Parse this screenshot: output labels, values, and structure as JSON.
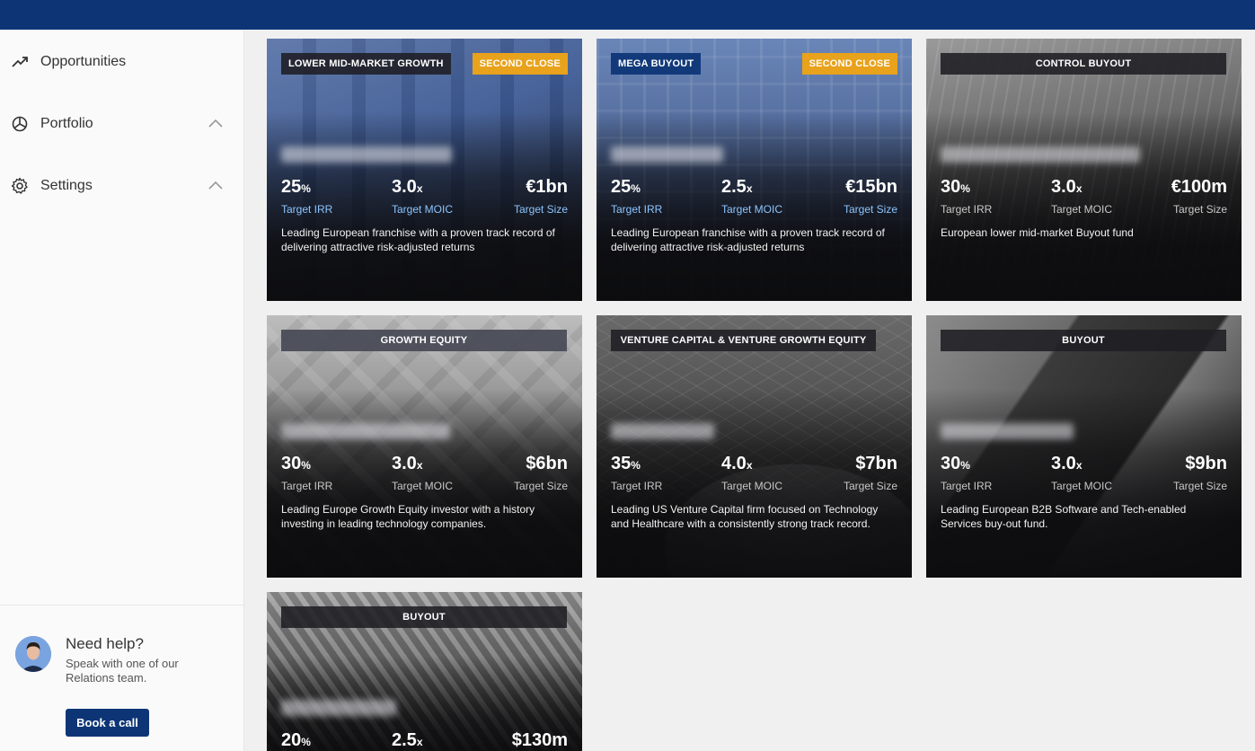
{
  "sidebar": {
    "items": [
      {
        "label": "Opportunities",
        "icon": "trending-up-icon"
      },
      {
        "label": "Portfolio",
        "icon": "pie-chart-icon"
      },
      {
        "label": "Settings",
        "icon": "gear-icon"
      }
    ]
  },
  "help": {
    "title": "Need help?",
    "line1": "Speak with one of our",
    "line2": "Relations team.",
    "button": "Book a call"
  },
  "cards": [
    {
      "tag": "LOWER MID-MARKET GROWTH",
      "badge": "SECOND CLOSE",
      "irr": "25",
      "irr_unit": "%",
      "moic": "3.0",
      "moic_unit": "x",
      "size": "€1bn",
      "irr_label": "Target IRR",
      "moic_label": "Target MOIC",
      "size_label": "Target Size",
      "desc": "Leading European franchise with a proven track record of delivering attractive risk-adjusted returns"
    },
    {
      "tag": "MEGA BUYOUT",
      "badge": "SECOND CLOSE",
      "irr": "25",
      "irr_unit": "%",
      "moic": "2.5",
      "moic_unit": "x",
      "size": "€15bn",
      "irr_label": "Target IRR",
      "moic_label": "Target MOIC",
      "size_label": "Target Size",
      "desc": "Leading European franchise with a proven track record of delivering attractive risk-adjusted returns"
    },
    {
      "tag": "CONTROL BUYOUT",
      "irr": "30",
      "irr_unit": "%",
      "moic": "3.0",
      "moic_unit": "x",
      "size": "€100m",
      "irr_label": "Target IRR",
      "moic_label": "Target MOIC",
      "size_label": "Target Size",
      "desc": "European lower mid-market Buyout fund"
    },
    {
      "tag": "GROWTH EQUITY",
      "irr": "30",
      "irr_unit": "%",
      "moic": "3.0",
      "moic_unit": "x",
      "size": "$6bn",
      "irr_label": "Target IRR",
      "moic_label": "Target MOIC",
      "size_label": "Target Size",
      "desc": "Leading Europe Growth Equity investor with a history investing in leading technology companies."
    },
    {
      "tag": "VENTURE CAPITAL & VENTURE GROWTH EQUITY",
      "irr": "35",
      "irr_unit": "%",
      "moic": "4.0",
      "moic_unit": "x",
      "size": "$7bn",
      "irr_label": "Target IRR",
      "moic_label": "Target MOIC",
      "size_label": "Target Size",
      "desc": "Leading US Venture Capital firm focused on Technology and Healthcare with a consistently strong track record."
    },
    {
      "tag": "BUYOUT",
      "irr": "30",
      "irr_unit": "%",
      "moic": "3.0",
      "moic_unit": "x",
      "size": "$9bn",
      "irr_label": "Target IRR",
      "moic_label": "Target MOIC",
      "size_label": "Target Size",
      "desc": "Leading European B2B Software and Tech-enabled Services buy-out fund."
    },
    {
      "tag": "BUYOUT",
      "irr": "20",
      "irr_unit": "%",
      "moic": "2.5",
      "moic_unit": "x",
      "size": "$130m"
    }
  ]
}
